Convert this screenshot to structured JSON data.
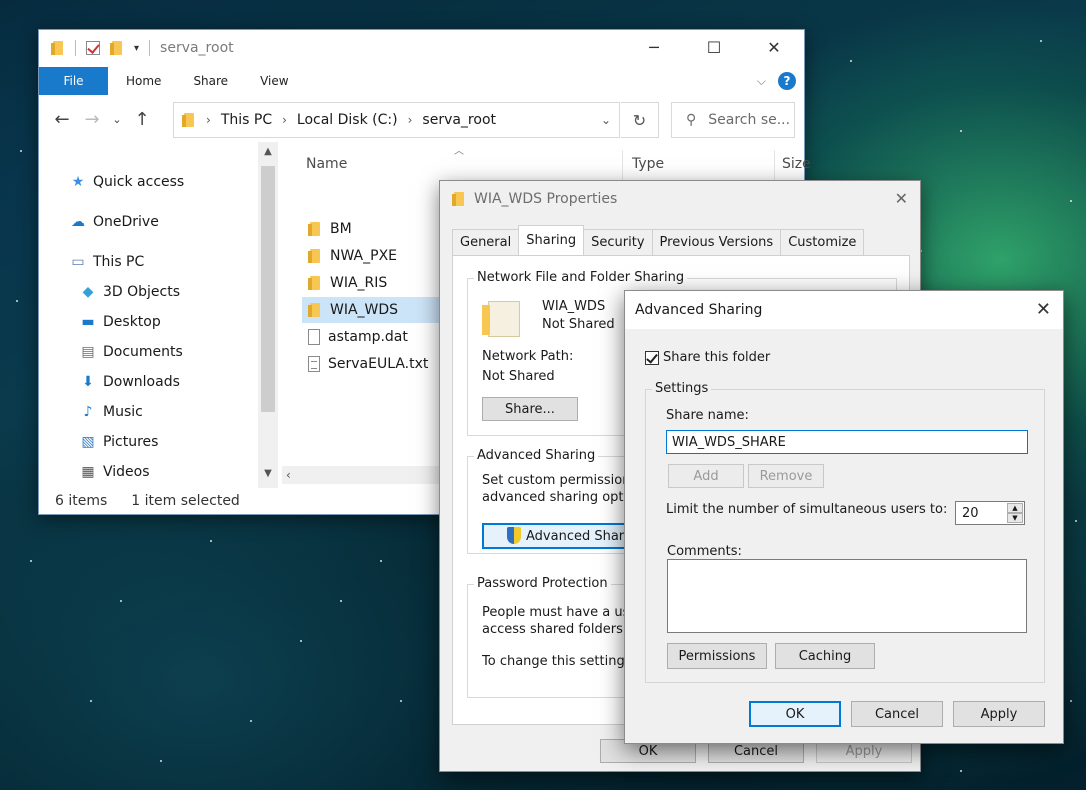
{
  "explorer": {
    "title": "serva_root",
    "ribbon_tabs": [
      "File",
      "Home",
      "Share",
      "View"
    ],
    "breadcrumb": [
      "This PC",
      "Local Disk (C:)",
      "serva_root"
    ],
    "search_placeholder": "Search se...",
    "nav_items": [
      "Quick access",
      "OneDrive",
      "This PC",
      "3D Objects",
      "Desktop",
      "Documents",
      "Downloads",
      "Music",
      "Pictures",
      "Videos"
    ],
    "columns": [
      "Name",
      "Type",
      "Size"
    ],
    "files": [
      "BM",
      "NWA_PXE",
      "WIA_RIS",
      "WIA_WDS",
      "astamp.dat",
      "ServaEULA.txt"
    ],
    "status": {
      "item_count": "6 items",
      "selected": "1 item selected"
    }
  },
  "properties": {
    "title": "WIA_WDS Properties",
    "tabs": [
      "General",
      "Sharing",
      "Security",
      "Previous Versions",
      "Customize"
    ],
    "network_group_title": "Network File and Folder Sharing",
    "folder_name": "WIA_WDS",
    "share_state": "Not Shared",
    "network_path_label": "Network Path:",
    "network_path_value": "Not Shared",
    "share_button": "Share...",
    "advanced_group_title": "Advanced Sharing",
    "advanced_desc_1": "Set custom permissions,",
    "advanced_desc_2": "advanced sharing optio",
    "advanced_button": "Advanced Sharin",
    "password_group_title": "Password Protection",
    "password_desc_1": "People must have a use",
    "password_desc_2": "access shared folders.",
    "password_desc_3": "To change this setting, u",
    "ok": "OK",
    "cancel": "Cancel",
    "apply": "Apply"
  },
  "advanced": {
    "title": "Advanced Sharing",
    "share_checkbox_label": "Share this folder",
    "settings_title": "Settings",
    "share_name_label": "Share name:",
    "share_name_value": "WIA_WDS_SHARE",
    "add_button": "Add",
    "remove_button": "Remove",
    "limit_label": "Limit the number of simultaneous users to:",
    "limit_value": "20",
    "comments_label": "Comments:",
    "permissions_button": "Permissions",
    "caching_button": "Caching",
    "ok": "OK",
    "cancel": "Cancel",
    "apply": "Apply"
  },
  "colors": {
    "accent": "#0078d7",
    "file_tab": "#1979ca",
    "selection": "#cce4f7",
    "folder": "#f7c653"
  }
}
